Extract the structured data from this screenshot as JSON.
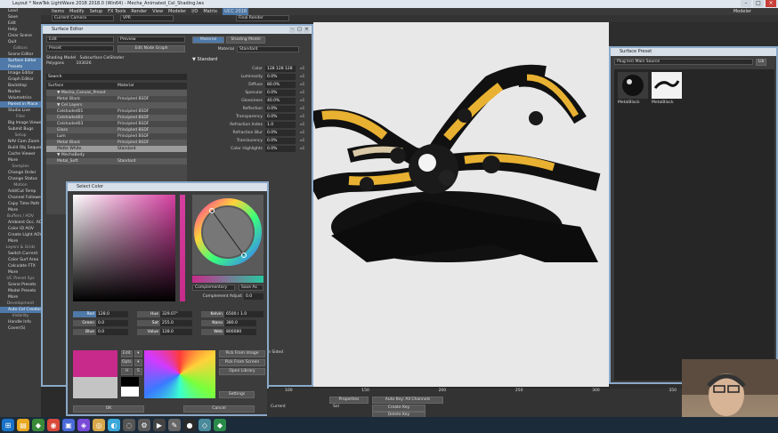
{
  "window": {
    "title": "Layout * NewTek LightWave 2018 2018.0 (Win64) - Mecha_Animated_Cel_Shading.lws"
  },
  "menu": {
    "items": [
      "Items",
      "Modify",
      "Setup",
      "FX Tools",
      "Render",
      "View",
      "Modeler",
      "I/O",
      "Matrix",
      "UCC 2018"
    ],
    "active_index": 9,
    "modeler_label": "Modeler"
  },
  "toolbar": {
    "camera": "Current Camera",
    "view_mode": "VPR",
    "render_mode": "Final Render"
  },
  "sidebar": {
    "items": [
      {
        "label": "Load",
        "type": "item"
      },
      {
        "label": "Save",
        "type": "item"
      },
      {
        "label": "Edit",
        "type": "item"
      },
      {
        "label": "Help",
        "type": "item"
      },
      {
        "label": "Clear Scene",
        "type": "item"
      },
      {
        "label": "Quit",
        "type": "item"
      },
      {
        "label": "Editors",
        "type": "hdr"
      },
      {
        "label": "Scene Editor",
        "type": "item"
      },
      {
        "label": "Surface Editor",
        "type": "sel"
      },
      {
        "label": "Presets",
        "type": "sel"
      },
      {
        "label": "Image Editor",
        "type": "item"
      },
      {
        "label": "Graph Editor",
        "type": "item"
      },
      {
        "label": "Backdrop",
        "type": "item"
      },
      {
        "label": "Nodes",
        "type": "item"
      },
      {
        "label": "Volumetrics",
        "type": "item"
      },
      {
        "label": "Parent in Place",
        "type": "sel"
      },
      {
        "label": "Studio Live",
        "type": "item"
      },
      {
        "label": "Files",
        "type": "hdr"
      },
      {
        "label": "Big Image Viewer",
        "type": "item"
      },
      {
        "label": "Submit Bugs",
        "type": "item"
      },
      {
        "label": "Setup",
        "type": "hdr"
      },
      {
        "label": "NAV Cam Zoom",
        "type": "item"
      },
      {
        "label": "Build Obj Sequence",
        "type": "item"
      },
      {
        "label": "Cache Viewer",
        "type": "item"
      },
      {
        "label": "More",
        "type": "item"
      },
      {
        "label": "Samples",
        "type": "hdr"
      },
      {
        "label": "Change Order",
        "type": "item"
      },
      {
        "label": "Change Status",
        "type": "item"
      },
      {
        "label": "Motion",
        "type": "hdr"
      },
      {
        "label": "Add/Cut Temp",
        "type": "item"
      },
      {
        "label": "Channel Follower",
        "type": "item"
      },
      {
        "label": "Copy Time Path",
        "type": "item"
      },
      {
        "label": "More",
        "type": "item"
      },
      {
        "label": "Buffers / AOV",
        "type": "hdr"
      },
      {
        "label": "Ambient Occ. AOV",
        "type": "item"
      },
      {
        "label": "Color ID AOV",
        "type": "item"
      },
      {
        "label": "Create Light AOV",
        "type": "item"
      },
      {
        "label": "More",
        "type": "item"
      },
      {
        "label": "Layers & Grids",
        "type": "hdr"
      },
      {
        "label": "Switch Current",
        "type": "item"
      },
      {
        "label": "Color Surf Area",
        "type": "item"
      },
      {
        "label": "Calculate FTX",
        "type": "item"
      },
      {
        "label": "More",
        "type": "item"
      },
      {
        "label": "UC Preset Sys",
        "type": "hdr"
      },
      {
        "label": "Scene Presets",
        "type": "item"
      },
      {
        "label": "Model Presets",
        "type": "item"
      },
      {
        "label": "More",
        "type": "item"
      },
      {
        "label": "Development",
        "type": "hdr"
      },
      {
        "label": "Auto Cel Creator",
        "type": "sel"
      },
      {
        "label": "Visibility",
        "type": "hdr"
      },
      {
        "label": "Handle Info",
        "type": "item"
      },
      {
        "label": "Cover(S)",
        "type": "item"
      }
    ]
  },
  "surface_editor": {
    "title": "Surface Editor",
    "edit_dd": "Edit",
    "preview_dd": "Preview",
    "preset_dd": "Preset",
    "edit_nodes_btn": "Edit Node Graph",
    "shading_model_label": "Shading Model",
    "shading_model_value": "Subsurface CelShader",
    "polygons_label": "Polygons",
    "polygons_value": "103026",
    "search_placeholder": "Search",
    "col_surface": "Surface",
    "col_material": "Material",
    "tabs": [
      "Material",
      "Shading Model"
    ],
    "material_label": "Material",
    "material_value": "Standard",
    "section": "Standard",
    "rows": [
      {
        "label": "Color",
        "value": "128  128  128"
      },
      {
        "label": "Luminosity",
        "value": "0.0%"
      },
      {
        "label": "Diffuse",
        "value": "80.0%"
      },
      {
        "label": "Specular",
        "value": "0.0%"
      },
      {
        "label": "Glossiness",
        "value": "40.0%"
      },
      {
        "label": "Reflection",
        "value": "0.0%"
      },
      {
        "label": "Transparency",
        "value": "0.0%"
      },
      {
        "label": "Refraction Index",
        "value": "1.0"
      },
      {
        "label": "Refraction Blur",
        "value": "0.0%"
      },
      {
        "label": "Translucency",
        "value": "0.0%"
      },
      {
        "label": "Color Highlights",
        "value": "0.0%"
      }
    ],
    "surfaces": [
      {
        "name": "▼ Mecha_Canvas_Preset",
        "mat": "",
        "style": "alt"
      },
      {
        "name": "Metal Black",
        "mat": "Principled BSDF",
        "style": ""
      },
      {
        "name": "▼ Cel Layers",
        "mat": "",
        "style": "alt"
      },
      {
        "name": "Celshaded01",
        "mat": "Principled BSDF",
        "style": ""
      },
      {
        "name": "Celshaded02",
        "mat": "Principled BSDF",
        "style": "alt"
      },
      {
        "name": "Celshaded03",
        "mat": "Principled BSDF",
        "style": ""
      },
      {
        "name": "Glass",
        "mat": "Principled BSDF",
        "style": "alt"
      },
      {
        "name": "Lum",
        "mat": "Principled BSDF",
        "style": ""
      },
      {
        "name": "Metal Black",
        "mat": "Principled BSDF",
        "style": "alt"
      },
      {
        "name": "Matte White",
        "mat": "Standard",
        "style": "sel"
      },
      {
        "name": "▼ MechaBody",
        "mat": "",
        "style": ""
      },
      {
        "name": "Metal_Soft",
        "mat": "Standard",
        "style": "alt"
      }
    ],
    "sideways_label": "Sideways",
    "smoothing_label": "Smoothing",
    "double_sided": "Double Sided",
    "comment": "Comment"
  },
  "select_color": {
    "title": "Select Color",
    "harmony_dd": "Complementary",
    "save_as_dd": "Save As",
    "complement_label": "Complement Adjust",
    "complement_value": "0.0",
    "fields": [
      {
        "label": "Red",
        "value": "128.0",
        "active": true
      },
      {
        "label": "Hue",
        "value": "329.07°",
        "active": false
      },
      {
        "label": "Kelvin",
        "value": "6500.0",
        "active": false
      },
      {
        "label": "Green",
        "value": "0.0",
        "active": false
      },
      {
        "label": "Sat",
        "value": "255.0",
        "active": false
      },
      {
        "label": "Nano",
        "value": "380.0",
        "active": false
      },
      {
        "label": "Blue",
        "value": "0.0",
        "active": false
      },
      {
        "label": "Value",
        "value": "128.0",
        "active": false
      },
      {
        "label": "Web",
        "value": "800080",
        "active": false
      }
    ],
    "mult_value": "1.0",
    "swatch_labels": [
      "Edit",
      "Opts",
      "H",
      "S"
    ],
    "pick_buttons": [
      "Pick From Image",
      "Pick From Screen",
      "Open Library"
    ],
    "settings_btn": "Settings",
    "ok_btn": "OK",
    "cancel_btn": "Cancel"
  },
  "surface_preset": {
    "title": "Surface Preset",
    "library_dd": "Plug Ins\\ Main Source",
    "lib_btn": "Lib",
    "presets": [
      {
        "label": "MetalBlack"
      },
      {
        "label": "MetalBlack"
      }
    ]
  },
  "timeline": {
    "ticks": [
      "100",
      "150",
      "200",
      "250",
      "300",
      "350"
    ],
    "properties_label": "Properties",
    "auto_key_label": "Auto Key: All Channels",
    "create_key_label": "Create Key",
    "delete_key_label": "Delete Key",
    "current_label": "Current",
    "sel_label": "Sel"
  },
  "colors": {
    "accent": "#4e79a8",
    "panel_bg": "#3c3c3c",
    "viewport_bg": "#e8e8e8",
    "color_swatch": "#c72a8a"
  }
}
